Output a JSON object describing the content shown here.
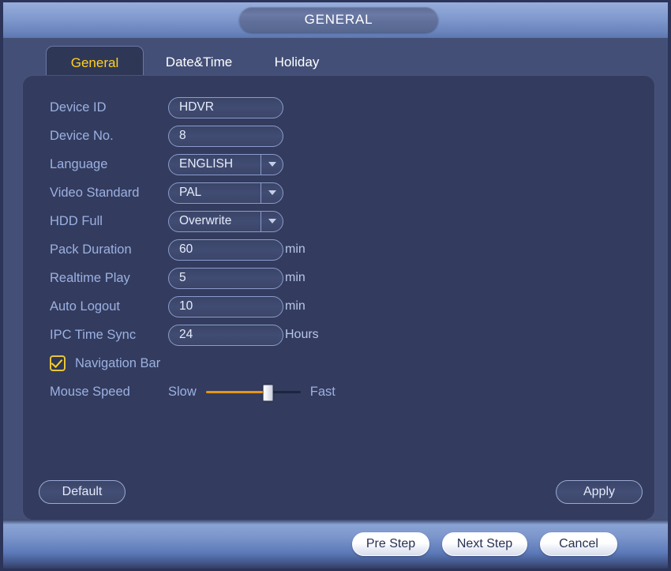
{
  "window": {
    "title": "GENERAL"
  },
  "tabs": [
    {
      "label": "General",
      "active": true
    },
    {
      "label": "Date&Time",
      "active": false
    },
    {
      "label": "Holiday",
      "active": false
    }
  ],
  "form": {
    "fields": [
      {
        "label": "Device ID",
        "type": "text",
        "value": "HDVR",
        "suffix": ""
      },
      {
        "label": "Device No.",
        "type": "text",
        "value": "8",
        "suffix": ""
      },
      {
        "label": "Language",
        "type": "select",
        "value": "ENGLISH",
        "suffix": ""
      },
      {
        "label": "Video Standard",
        "type": "select",
        "value": "PAL",
        "suffix": ""
      },
      {
        "label": "HDD Full",
        "type": "select",
        "value": "Overwrite",
        "suffix": ""
      },
      {
        "label": "Pack Duration",
        "type": "text",
        "value": "60",
        "suffix": "min"
      },
      {
        "label": "Realtime Play",
        "type": "text",
        "value": "5",
        "suffix": "min"
      },
      {
        "label": "Auto Logout",
        "type": "text",
        "value": "10",
        "suffix": "min"
      },
      {
        "label": "IPC Time Sync",
        "type": "text",
        "value": "24",
        "suffix": "Hours"
      }
    ],
    "navigation_bar": {
      "label": "Navigation Bar",
      "checked": true
    },
    "mouse_speed": {
      "label": "Mouse Speed",
      "min_label": "Slow",
      "max_label": "Fast",
      "value_percent": 62
    }
  },
  "panel_buttons": {
    "default_label": "Default",
    "apply_label": "Apply"
  },
  "wizard_buttons": [
    {
      "label": "Pre Step"
    },
    {
      "label": "Next Step"
    },
    {
      "label": "Cancel"
    }
  ],
  "colors": {
    "frame": "#2c345a",
    "tabstrip": "#434f77",
    "panel": "#333c5e",
    "active_tab_text": "#ffd21e",
    "label_text": "#9cb0e2",
    "value_text": "#e6ecf9",
    "slider_fill": "#e8941a",
    "checkbox_border": "#e8c53a"
  }
}
